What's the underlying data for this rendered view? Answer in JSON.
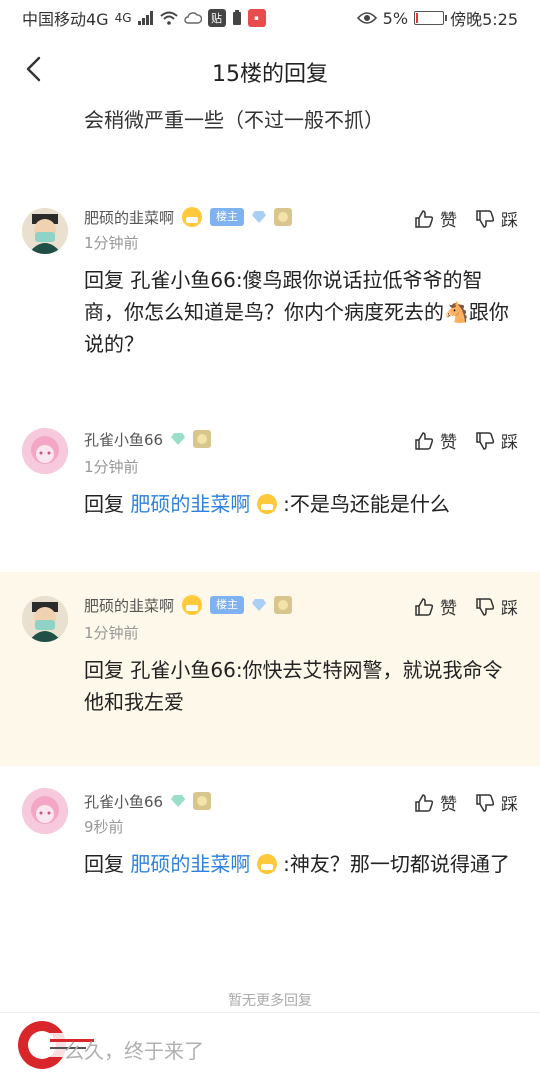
{
  "status_bar": {
    "carrier": "中国移动4G",
    "network_badge": "4G",
    "tieba_badge": "贴",
    "battery_percent": "5%",
    "battery_level": 0.05,
    "time": "傍晚5:25",
    "colors": {
      "battery_low": "#e53935"
    }
  },
  "nav": {
    "title": "15楼的回复"
  },
  "tail_text": "会稍微严重一些（不过一般不抓）",
  "actions": {
    "like": "赞",
    "dislike": "踩"
  },
  "posts": [
    {
      "author": "肥硕的韭菜啊",
      "badge": "楼主",
      "time": "1分钟前",
      "reply_prefix": "回复",
      "reply_target": "孔雀小鱼66",
      "body": ":傻鸟跟你说话拉低爷爷的智商，你怎么知道是鸟？你内个病度死去的🐴跟你说的？"
    },
    {
      "author": "孔雀小鱼66",
      "time": "1分钟前",
      "reply_prefix": "回复",
      "reply_target": "肥硕的韭菜啊",
      "body": ":不是鸟还能是什么"
    },
    {
      "author": "肥硕的韭菜啊",
      "badge": "楼主",
      "time": "1分钟前",
      "reply_prefix": "回复",
      "reply_target": "孔雀小鱼66",
      "body": ":你快去艾特网警，就说我命令他和我左爱"
    },
    {
      "author": "孔雀小鱼66",
      "time": "9秒前",
      "reply_prefix": "回复",
      "reply_target": "肥硕的韭菜啊",
      "body": ":神友？那一切都说得通了"
    }
  ],
  "footer": {
    "no_more": "暂无更多回复",
    "reply_placeholder": "么久，终于来了"
  },
  "colors": {
    "link": "#2e82dc",
    "highlight_bg": "#fdf8ea",
    "lz_badge": "#7fb2f0"
  }
}
